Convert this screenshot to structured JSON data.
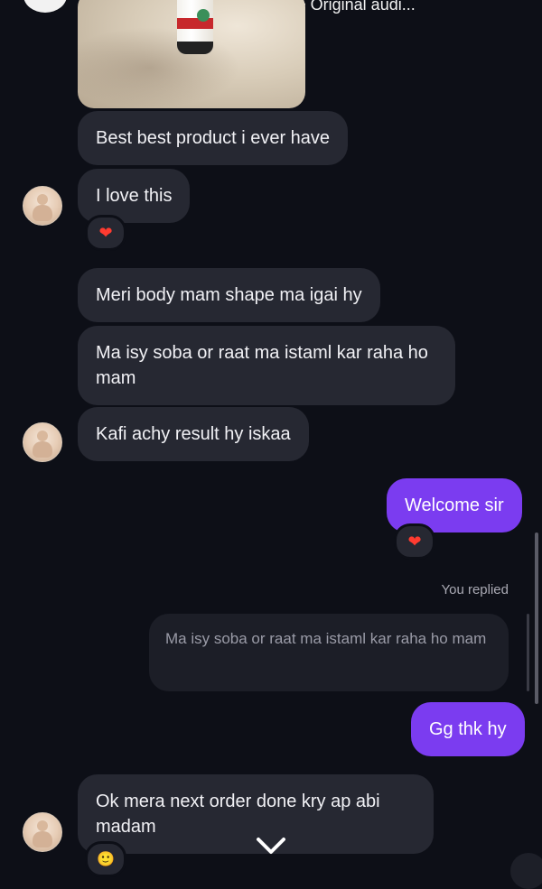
{
  "header": {
    "audio_text": "mohammed_majidhussain • Original audi..."
  },
  "messages": [
    {
      "id": "m1",
      "text": "Best best product i ever have"
    },
    {
      "id": "m2",
      "text": "I love this",
      "reaction": "heart"
    },
    {
      "id": "m3",
      "text": "Meri body mam shape ma igai hy"
    },
    {
      "id": "m4",
      "text": "Ma isy soba or raat ma istaml kar raha ho mam"
    },
    {
      "id": "m5",
      "text": "Kafi achy result hy iskaa"
    },
    {
      "id": "m6",
      "text": "Welcome sir",
      "reaction": "heart"
    },
    {
      "id": "m7",
      "text": "Gg thk hy"
    },
    {
      "id": "m8",
      "text": "Ok mera next order done kry ap abi madam",
      "reaction": "smile"
    }
  ],
  "reply": {
    "label": "You replied",
    "quoted_text": "Ma isy soba or raat ma istaml kar raha ho mam"
  },
  "icons": {
    "music": "music-note-icon",
    "heart": "heart-icon",
    "scroll_down": "chevron-down-icon"
  },
  "colors": {
    "background": "#0d0f17",
    "incoming_bubble": "#262832",
    "outgoing_bubble": "#7b3cf0",
    "reaction_heart": "#ff3b30"
  }
}
